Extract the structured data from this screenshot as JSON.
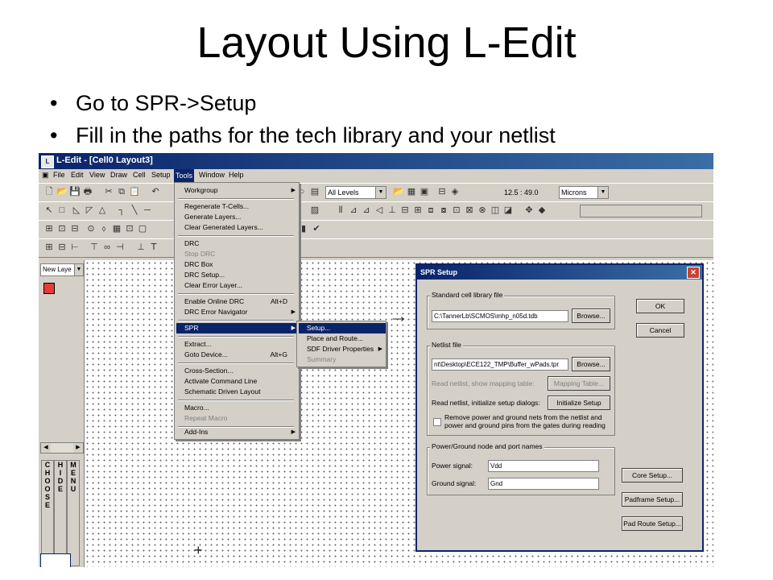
{
  "slide": {
    "title": "Layout Using L-Edit",
    "bullets": [
      "Go to SPR->Setup",
      "Fill in the paths for the tech library and your netlist"
    ]
  },
  "window": {
    "title": "L-Edit - [Cell0     Layout3]",
    "menus": [
      "File",
      "Edit",
      "View",
      "Draw",
      "Cell",
      "Setup",
      "Tools",
      "Window",
      "Help"
    ],
    "active_menu": "Tools"
  },
  "toolbar": {
    "layer_combo": "All Levels",
    "coordinates": "12.5 : 49.0",
    "units_combo": "Microns"
  },
  "left_panel": {
    "layer_combo": "New Laye",
    "tabs": [
      "C\nH\nO\nO\nS\nE",
      "H\nI\nD\nE",
      "M\nE\nN\nU"
    ]
  },
  "tools_menu": {
    "items": [
      {
        "label": "Workgroup",
        "submenu": true
      },
      {
        "label": "Regenerate T-Cells..."
      },
      {
        "label": "Generate Layers..."
      },
      {
        "label": "Clear Generated Layers..."
      },
      {
        "label": "DRC"
      },
      {
        "label": "Stop DRC",
        "disabled": true
      },
      {
        "label": "DRC Box"
      },
      {
        "label": "DRC Setup..."
      },
      {
        "label": "Clear Error Layer..."
      },
      {
        "label": "Enable Online DRC",
        "shortcut": "Alt+D"
      },
      {
        "label": "DRC Error Navigator",
        "submenu": true
      },
      {
        "label": "SPR",
        "submenu": true,
        "highlighted": true
      },
      {
        "label": "Extract..."
      },
      {
        "label": "Goto Device...",
        "shortcut": "Alt+G"
      },
      {
        "label": "Cross-Section..."
      },
      {
        "label": "Activate Command Line"
      },
      {
        "label": "Schematic Driven Layout"
      },
      {
        "label": "Macro..."
      },
      {
        "label": "Repeat Macro",
        "disabled": true
      },
      {
        "label": "Add-Ins",
        "submenu": true
      }
    ]
  },
  "spr_submenu": {
    "items": [
      {
        "label": "Setup...",
        "highlighted": true
      },
      {
        "label": "Place and Route..."
      },
      {
        "label": "SDF Driver Properties",
        "submenu": true
      },
      {
        "label": "Summary",
        "disabled": true
      }
    ]
  },
  "spr_dialog": {
    "title": "SPR Setup",
    "close": "✕",
    "std_cell_group": "Standard cell library file",
    "std_cell_path": "C:\\TannerLb\\SCMOS\\mhp_n05d.tdb",
    "browse1": "Browse...",
    "netlist_group": "Netlist file",
    "netlist_path": "nt\\Desktop\\ECE122_TMP\\Buffer_wPads.tpr",
    "browse2": "Browse...",
    "read_mapping_label": "Read netlist, show mapping table:",
    "mapping_button": "Mapping Table...",
    "read_init_label": "Read netlist, initialize setup dialogs:",
    "init_button": "Initialize Setup",
    "remove_power_label1": "Remove power and ground nets from the netlist and",
    "remove_power_label2": "power and ground pins from the gates during reading",
    "power_group": "Power/Ground node and port names",
    "power_label": "Power signal:",
    "power_value": "Vdd",
    "ground_label": "Ground signal:",
    "ground_value": "Gnd",
    "ok": "OK",
    "cancel": "Cancel",
    "core_setup": "Core Setup...",
    "padframe_setup": "Padframe Setup...",
    "pad_route_setup": "Pad Route Setup..."
  }
}
